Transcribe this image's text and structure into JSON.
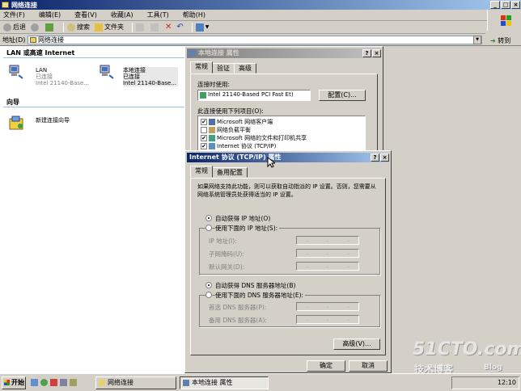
{
  "explorer": {
    "title": "网络连接",
    "menu": [
      "文件(F)",
      "编辑(E)",
      "查看(V)",
      "收藏(A)",
      "工具(T)",
      "帮助(H)"
    ],
    "toolbar": {
      "back": "后退",
      "search": "搜索",
      "folders": "文件夹"
    },
    "address_label": "地址(D)",
    "address_value": "网络连接",
    "go_label": "转到",
    "section_lan": "LAN 或高速 Internet",
    "section_wizard": "向导",
    "connections": [
      {
        "name": "LAN",
        "status": "已连接",
        "device": "Intel 21140-Base..."
      },
      {
        "name": "本地连接",
        "status": "已连接",
        "device": "Intel 21140-Base..."
      }
    ],
    "wizard_label": "新建连接向导"
  },
  "dialog1": {
    "title": "本地连接 属性",
    "tabs": [
      "常规",
      "验证",
      "高级"
    ],
    "connect_using_label": "连接时使用:",
    "adapter": "Intel 21140-Based PCI Fast Et)",
    "configure_button": "配置(C)...",
    "items_label": "此连接使用下列项目(O):",
    "items": [
      {
        "label": "Microsoft 网络客户端",
        "checked": true
      },
      {
        "label": "网络负载平衡",
        "checked": false
      },
      {
        "label": "Microsoft 网络的文件和打印机共享",
        "checked": true
      },
      {
        "label": "Internet 协议 (TCP/IP)",
        "checked": true
      }
    ],
    "ok_button": "确定",
    "cancel_button": "取消"
  },
  "dialog2": {
    "title": "Internet 协议 (TCP/IP) 属性",
    "tabs": [
      "常规",
      "备用配置"
    ],
    "description": "如果网络支持此功能，则可以获取自动指派的 IP 设置。否则，您需要从网络系统管理员处获得适当的 IP 设置。",
    "radio_auto_ip": "自动获得 IP 地址(O)",
    "radio_manual_ip": "使用下面的 IP 地址(S):",
    "ip_label": "IP 地址(I):",
    "mask_label": "子网掩码(U):",
    "gateway_label": "默认网关(D):",
    "radio_auto_dns": "自动获得 DNS 服务器地址(B)",
    "radio_manual_dns": "使用下面的 DNS 服务器地址(E):",
    "dns1_label": "首选 DNS 服务器(P):",
    "dns2_label": "备用 DNS 服务器(A):",
    "advanced_button": "高级(V)...",
    "ok_button": "确定",
    "cancel_button": "取消",
    "ip_dots": "."
  },
  "taskbar": {
    "start": "开始",
    "items": [
      "网络连接",
      "本地连接 属性"
    ],
    "clock": "12:10"
  },
  "watermark": {
    "site": "51CTO.com",
    "blog": "技术博客",
    "blog_suffix": "Blog"
  }
}
